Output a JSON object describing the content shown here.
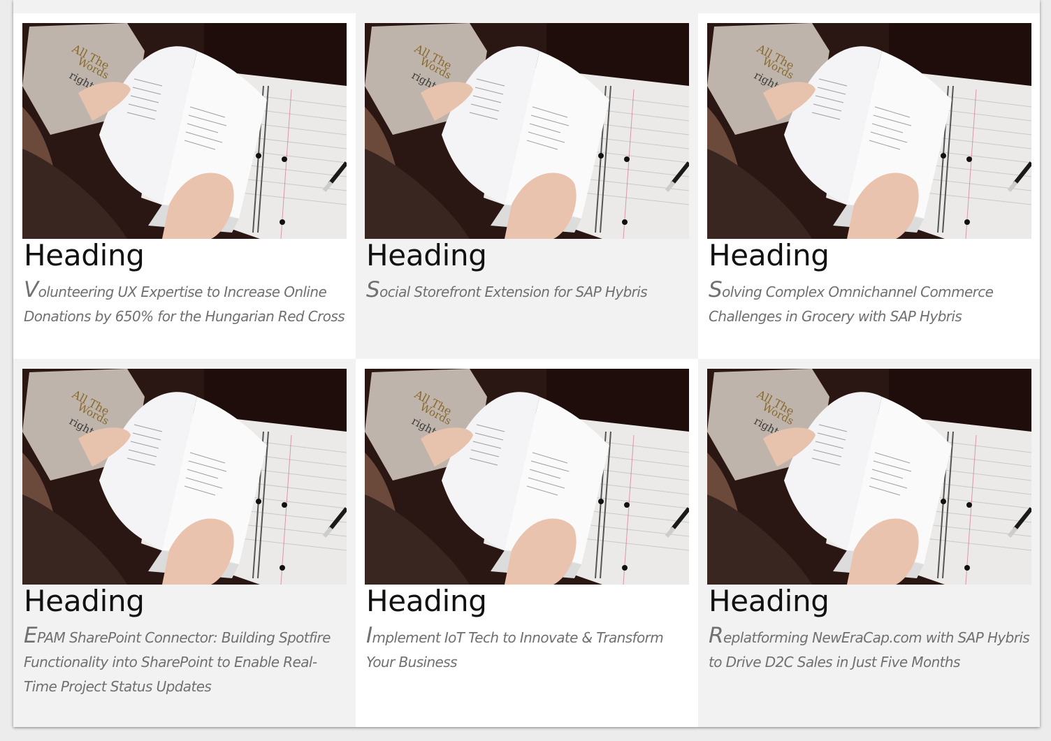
{
  "cards": [
    {
      "heading": "Heading",
      "description": "Volunteering UX Expertise to Increase Online Donations by 650% for the Hungarian Red Cross"
    },
    {
      "heading": "Heading",
      "description": "Social Storefront Extension for SAP Hybris"
    },
    {
      "heading": "Heading",
      "description": "Solving Complex Omnichannel Commerce Challenges in Grocery with SAP Hybris"
    },
    {
      "heading": "Heading",
      "description": "EPAM SharePoint Connector: Building Spotfire Functionality into SharePoint to Enable Real-Time Project Status Updates"
    },
    {
      "heading": "Heading",
      "description": "Implement IoT Tech to Innovate & Transform Your Business"
    },
    {
      "heading": "Heading",
      "description": "Replatforming NewEraCap.com with SAP Hybris to Drive D2C Sales in Just Five Months"
    }
  ],
  "colors": {
    "card_white": "#ffffff",
    "card_grey": "#f2f2f2",
    "heading_text": "#111111",
    "description_text": "#707070"
  },
  "image": {
    "icon": "book-notebook-photo-icon"
  }
}
